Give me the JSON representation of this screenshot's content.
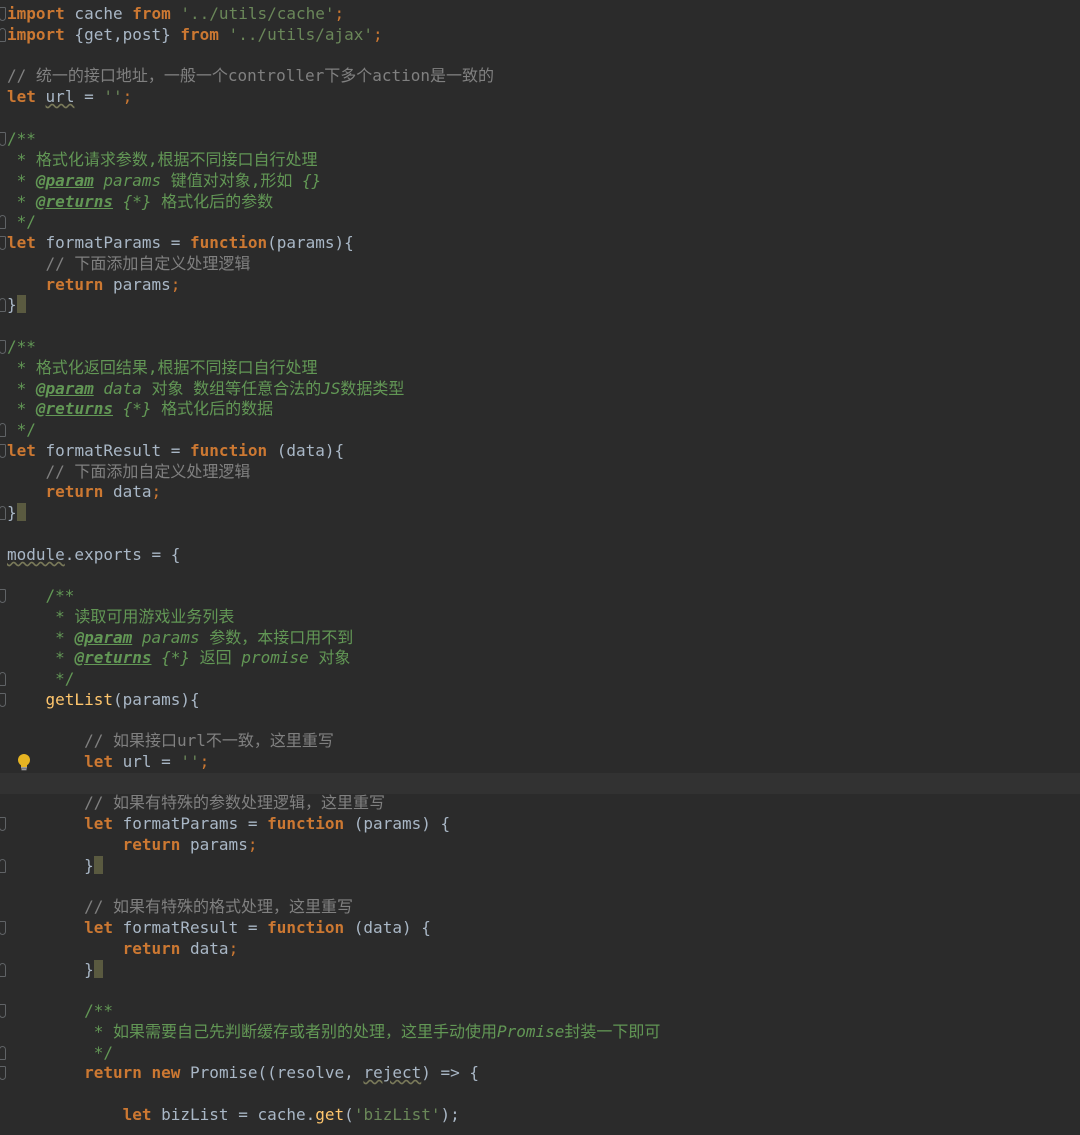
{
  "editor": {
    "theme_colors": {
      "background": "#2b2b2b",
      "keyword": "#cc7832",
      "string": "#6a8759",
      "comment": "#808080",
      "doc_comment": "#629755",
      "function": "#ffc66d",
      "text": "#a9b7c6"
    },
    "lines": {
      "l1": {
        "kw": "import",
        "name": " cache ",
        "from": "from",
        "str": " '../utils/cache'",
        "semi": ";"
      },
      "l2": {
        "kw": "import",
        "name": " {get,post} ",
        "from": "from",
        "str": " '../utils/ajax'",
        "semi": ";"
      },
      "l4": {
        "comment": "// 统一的接口地址，一般一个controller下多个action是一致的"
      },
      "l5": {
        "kw": "let",
        "var": "url",
        "eq": " = ",
        "str": "''",
        "semi": ";"
      },
      "l7": {
        "doc": "/**"
      },
      "l8": {
        "doc": " * 格式化请求参数,根据不同接口自行处理"
      },
      "l9": {
        "star": " * ",
        "tag": "@param",
        "rest": " params",
        "desc": " 键值对对象,形如 ",
        "type": "{}"
      },
      "l10": {
        "star": " * ",
        "tag": "@returns",
        "type": " {*}",
        "desc": " 格式化后的参数"
      },
      "l11": {
        "doc": " */"
      },
      "l12": {
        "kw": "let",
        "name": " formatParams = ",
        "fn": "function",
        "rest": "(params){"
      },
      "l13": {
        "comment": "    // 下面添加自定义处理逻辑"
      },
      "l14": {
        "kw": "    return",
        "rest": " params",
        "semi": ";"
      },
      "l15": {
        "brace": "}"
      },
      "l17": {
        "doc": "/**"
      },
      "l18": {
        "doc": " * 格式化返回结果,根据不同接口自行处理"
      },
      "l19": {
        "star": " * ",
        "tag": "@param",
        "rest": " data",
        "desc": " 对象 数组等任意合法的",
        "js": "JS",
        "desc2": "数据类型"
      },
      "l20": {
        "star": " * ",
        "tag": "@returns",
        "type": " {*}",
        "desc": " 格式化后的数据"
      },
      "l21": {
        "doc": " */"
      },
      "l22": {
        "kw": "let",
        "name": " formatResult = ",
        "fn": "function",
        "rest": " (data){"
      },
      "l23": {
        "comment": "    // 下面添加自定义处理逻辑"
      },
      "l24": {
        "kw": "    return",
        "rest": " data",
        "semi": ";"
      },
      "l25": {
        "brace": "}"
      },
      "l27": {
        "mod": "module",
        "rest": ".exports = {"
      },
      "l29": {
        "doc": "    /**"
      },
      "l30": {
        "doc": "     * 读取可用游戏业务列表"
      },
      "l31": {
        "star": "     * ",
        "tag": "@param",
        "rest": " params",
        "desc": " 参数，本接口用不到"
      },
      "l32": {
        "star": "     * ",
        "tag": "@returns",
        "type": " {*}",
        "desc": " 返回 ",
        "promise": "promise",
        "desc2": " 对象"
      },
      "l33": {
        "doc": "     */"
      },
      "l34": {
        "fn": "    getList",
        "rest": "(params){"
      },
      "l36": {
        "comment": "        // 如果接口url不一致，这里重写"
      },
      "l37": {
        "kw": "        let",
        "name": " url = ",
        "str": "''",
        "semi": ";"
      },
      "l39": {
        "comment": "        // 如果有特殊的参数处理逻辑，这里重写"
      },
      "l40": {
        "kw": "        let",
        "name": " formatParams = ",
        "fn": "function",
        "rest": " (params) {"
      },
      "l41": {
        "kw": "            return",
        "rest": " params",
        "semi": ";"
      },
      "l42": {
        "indent": "        ",
        "brace": "}"
      },
      "l44": {
        "comment": "        // 如果有特殊的格式处理，这里重写"
      },
      "l45": {
        "kw": "        let",
        "name": " formatResult = ",
        "fn": "function",
        "rest": " (data) {"
      },
      "l46": {
        "kw": "            return",
        "rest": " data",
        "semi": ";"
      },
      "l47": {
        "indent": "        ",
        "brace": "}"
      },
      "l49": {
        "doc": "        /**"
      },
      "l50": {
        "doc": "         * 如果需要自己先判断缓存或者别的处理，这里手动使用",
        "promise": "Promise",
        "doc2": "封装一下即可"
      },
      "l51": {
        "doc": "         */"
      },
      "l52": {
        "kw": "        return",
        "sp": " ",
        "new": "new",
        "name": " Promise((resolve, ",
        "reject": "reject",
        "rest": ") => {"
      },
      "l54": {
        "kw": "            let",
        "name": " bizList = cache.",
        "fn": "get",
        "p1": "(",
        "str": "'bizList'",
        "rest": ");"
      }
    }
  }
}
